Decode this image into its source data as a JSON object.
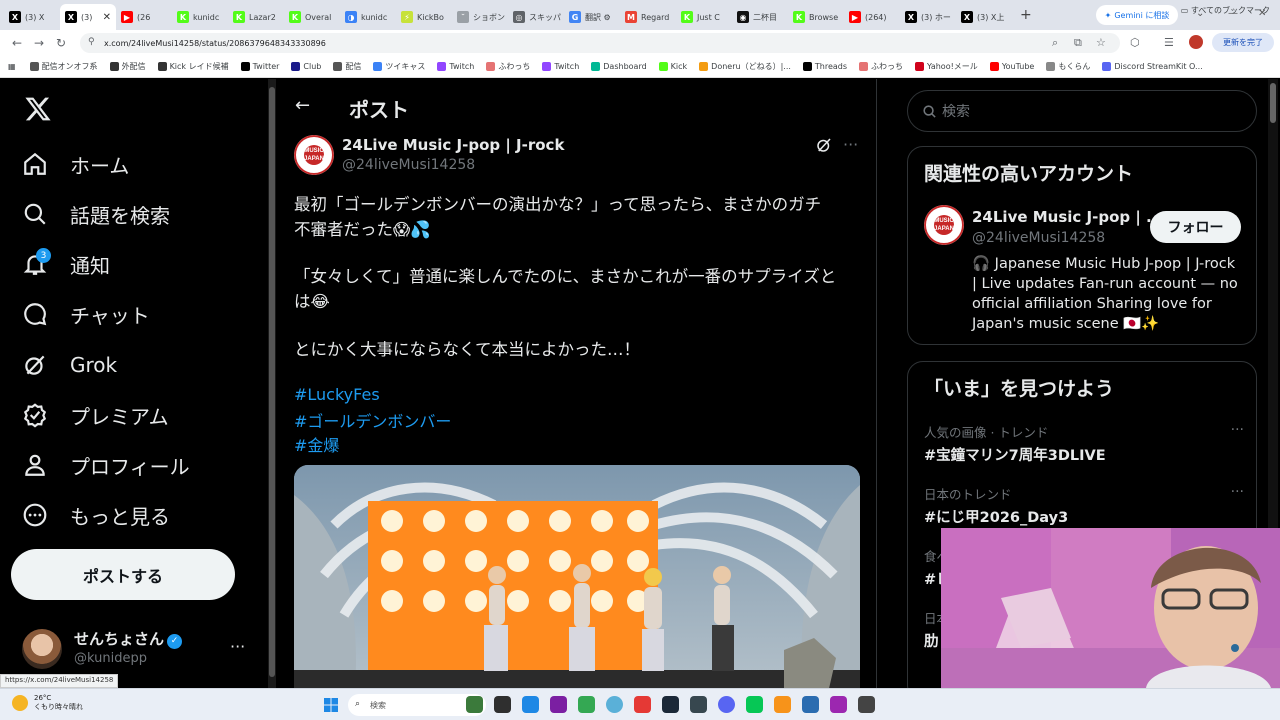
{
  "browser": {
    "tabs": [
      {
        "label": "(3) X",
        "color": "#000000",
        "glyph": "X"
      },
      {
        "label": "(3)",
        "color": "#000000",
        "glyph": "X",
        "active": true
      },
      {
        "label": "(26",
        "color": "#ff0000",
        "glyph": "▶"
      },
      {
        "label": "kunidc",
        "color": "#53fc18",
        "glyph": "K"
      },
      {
        "label": "Lazar2",
        "color": "#53fc18",
        "glyph": "K"
      },
      {
        "label": "Overal",
        "color": "#53fc18",
        "glyph": "K"
      },
      {
        "label": "kunidc",
        "color": "#3b82f6",
        "glyph": "◑"
      },
      {
        "label": "KickBo",
        "color": "#c7e23a",
        "glyph": "⚡"
      },
      {
        "label": "ショボン",
        "color": "#9aa0a6",
        "glyph": "˘"
      },
      {
        "label": "スキッパ",
        "color": "#5f6368",
        "glyph": "◎"
      },
      {
        "label": "翻訳 ⚙",
        "color": "#4285f4",
        "glyph": "G"
      },
      {
        "label": "Regard",
        "color": "#ea4335",
        "glyph": "M"
      },
      {
        "label": "Just C",
        "color": "#53fc18",
        "glyph": "K"
      },
      {
        "label": "二杯目",
        "color": "#111111",
        "glyph": "◉"
      },
      {
        "label": "Browse",
        "color": "#53fc18",
        "glyph": "K"
      },
      {
        "label": "(264)",
        "color": "#ff0000",
        "glyph": "▶"
      },
      {
        "label": "(3) ホー",
        "color": "#000000",
        "glyph": "X"
      },
      {
        "label": "(3) X上",
        "color": "#000000",
        "glyph": "X"
      }
    ],
    "tab_close": "✕",
    "new_tab": "+",
    "gemini_label": "Gemini に相談",
    "url": "x.com/24liveMusi14258/status/2086379648343330896",
    "update_label": "更新を完了",
    "bookmarks": [
      {
        "label": "配信オンオフ系",
        "color": "#555555"
      },
      {
        "label": "外配信",
        "color": "#333333"
      },
      {
        "label": "Kick レイド候補",
        "color": "#333333"
      },
      {
        "label": "Twitter",
        "color": "#000000"
      },
      {
        "label": "Club",
        "color": "#1a1a8a"
      },
      {
        "label": "配信",
        "color": "#555555"
      },
      {
        "label": "ツイキャス",
        "color": "#3b82f6"
      },
      {
        "label": "Twitch",
        "color": "#9146ff"
      },
      {
        "label": "ふわっち",
        "color": "#e57373"
      },
      {
        "label": "Twitch",
        "color": "#9146ff"
      },
      {
        "label": "Dashboard",
        "color": "#00b894"
      },
      {
        "label": "Kick",
        "color": "#53fc18"
      },
      {
        "label": "Doneru（どねる）|...",
        "color": "#f39c12"
      },
      {
        "label": "Threads",
        "color": "#000000"
      },
      {
        "label": "ふわっち",
        "color": "#e57373"
      },
      {
        "label": "Yahoo!メール",
        "color": "#d0021b"
      },
      {
        "label": "YouTube",
        "color": "#ff0000"
      },
      {
        "label": "もくらん",
        "color": "#888888"
      },
      {
        "label": "Discord StreamKit O...",
        "color": "#5865f2"
      }
    ],
    "all_bookmarks": "すべてのブックマーク",
    "status_url": "https://x.com/24liveMusi14258"
  },
  "nav": {
    "items": [
      {
        "label": "ホーム",
        "icon": "home-icon"
      },
      {
        "label": "話題を検索",
        "icon": "search-icon"
      },
      {
        "label": "通知",
        "icon": "bell-icon",
        "badge": "3"
      },
      {
        "label": "チャット",
        "icon": "chat-icon"
      },
      {
        "label": "Grok",
        "icon": "grok-icon"
      },
      {
        "label": "プレミアム",
        "icon": "premium-icon"
      },
      {
        "label": "プロフィール",
        "icon": "profile-icon"
      },
      {
        "label": "もっと見る",
        "icon": "more-icon"
      }
    ],
    "post_button": "ポストする",
    "profile": {
      "name": "せんちょさん",
      "handle": "@kunidepp"
    }
  },
  "post": {
    "title": "ポスト",
    "author_name": "24Live Music J-pop | J-rock",
    "author_handle": "@24liveMusi14258",
    "lines": [
      "最初「ゴールデンボンバーの演出かな？」って思ったら、まさかのガチ",
      "不審者だった😱💦",
      "「女々しくて」普通に楽しんでたのに、まさかこれが一番のサプライズと",
      "は😂",
      "とにかく大事にならなくて本当によかった…！"
    ],
    "hashtags": [
      "#LuckyFes",
      "#ゴールデンボンバー",
      "#金爆"
    ],
    "avatar_text": "MUSIC JAPAN"
  },
  "sidebar": {
    "search_placeholder": "検索",
    "related_title": "関連性の高いアカウント",
    "related": {
      "name": "24Live Music J-pop | ...",
      "handle": "@24liveMusi14258",
      "follow": "フォロー",
      "bio": "🎧 Japanese Music Hub J-pop | J-rock | Live updates Fan-run account — no official affiliation Sharing love for Japan's music scene 🇯🇵✨"
    },
    "trends_title": "「いま」を見つけよう",
    "trends": [
      {
        "meta": "人気の画像 · トレンド",
        "name": "#宝鐘マリン7周年3DLIVE"
      },
      {
        "meta": "日本のトレンド",
        "name": "#にじ甲2026_Day3"
      },
      {
        "meta": "食べ",
        "name": "#レ"
      },
      {
        "meta": "日本",
        "name": "肋"
      }
    ],
    "trend_more": "···"
  },
  "taskbar": {
    "weather_temp": "26°C",
    "weather_desc": "くもり時々晴れ",
    "search": "検索",
    "apps": [
      "#3b7a3b",
      "#2f2f2f",
      "#1e88e5",
      "#7b1fa2",
      "#34a853",
      "#5ab0d8",
      "#e53935",
      "#1b2838",
      "#37474f",
      "#5865f2",
      "#06c755",
      "#f7931a",
      "#2b6cb0",
      "#9c27b0",
      "#444444"
    ]
  },
  "colors": {
    "accent": "#1d9bf0",
    "bg": "#000000",
    "text": "#e7e9ea",
    "muted": "#71767b",
    "border": "#2f3336"
  }
}
